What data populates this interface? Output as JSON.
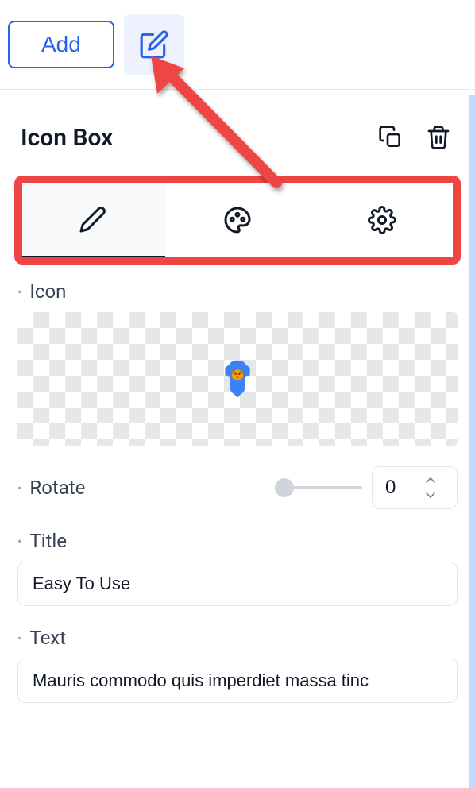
{
  "toolbar": {
    "add_label": "Add"
  },
  "panel": {
    "title": "Icon Box"
  },
  "fields": {
    "icon": {
      "label": "Icon",
      "preview_icon": "baby-onesie"
    },
    "rotate": {
      "label": "Rotate",
      "value": "0",
      "min": 0,
      "max": 360
    },
    "title": {
      "label": "Title",
      "value": "Easy To Use"
    },
    "text": {
      "label": "Text",
      "value": "Mauris commodo quis imperdiet massa tinc"
    }
  },
  "tabs": {
    "content": "Content",
    "style": "Style",
    "advanced": "Advanced"
  },
  "annotations": {
    "arrow_color": "#ef4444",
    "highlight_color": "#ef4444"
  }
}
